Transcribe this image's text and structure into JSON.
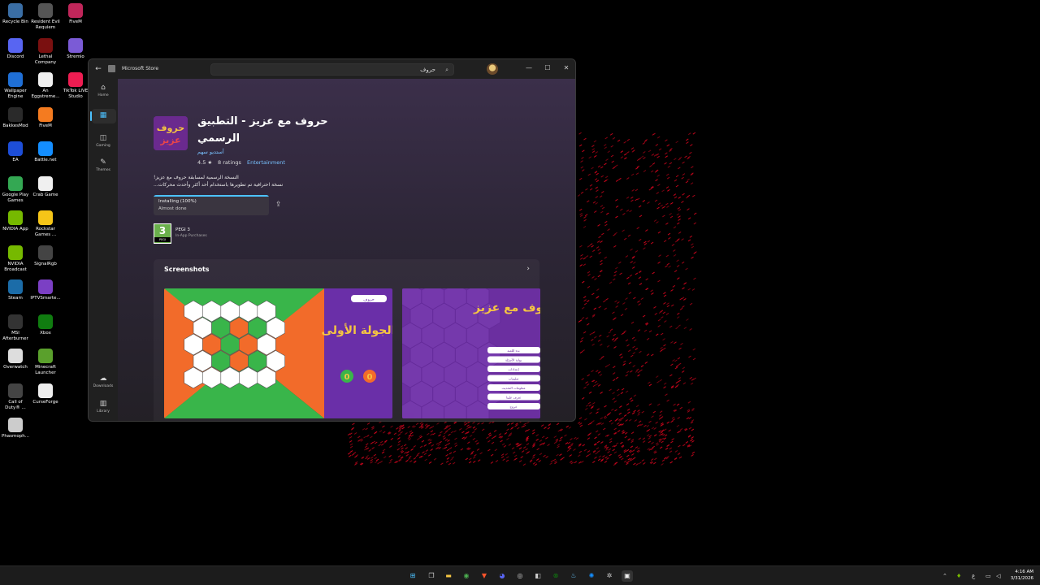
{
  "desktop": {
    "icons": [
      {
        "label": "Recycle Bin",
        "icon": "recycle-bin-icon",
        "color": "#3a6ea5"
      },
      {
        "label": "Resident Evil\nRequiem",
        "icon": "game-icon",
        "color": "#555555"
      },
      {
        "label": "FiveM",
        "icon": "fivem-icon",
        "color": "#c0265a"
      },
      {
        "label": "Discord",
        "icon": "discord-icon",
        "color": "#5865f2"
      },
      {
        "label": "Lethal\nCompany",
        "icon": "game-icon",
        "color": "#7a1010"
      },
      {
        "label": "Stremio",
        "icon": "stremio-icon",
        "color": "#7b5bd6"
      },
      {
        "label": "Wallpaper\nEngine",
        "icon": "wallpaper-engine-icon",
        "color": "#1f6fd6"
      },
      {
        "label": "An\nEggstreme...",
        "icon": "document-icon",
        "color": "#f0f0f0"
      },
      {
        "label": "TikTok LIVE\nStudio",
        "icon": "tiktok-icon",
        "color": "#ee1d52"
      },
      {
        "label": "BakkesMod",
        "icon": "bakkesmod-icon",
        "color": "#2a2a2a"
      },
      {
        "label": "FiveM",
        "icon": "fivem-icon",
        "color": "#f47b20"
      },
      {
        "label": "EA",
        "icon": "ea-icon",
        "color": "#1d4ed8"
      },
      {
        "label": "Battle.net",
        "icon": "battlenet-icon",
        "color": "#148eff"
      },
      {
        "label": "Google Play\nGames",
        "icon": "google-play-icon",
        "color": "#34a853"
      },
      {
        "label": "Crab Game",
        "icon": "document-icon",
        "color": "#f0f0f0"
      },
      {
        "label": "NVIDIA App",
        "icon": "nvidia-icon",
        "color": "#76b900"
      },
      {
        "label": "Rockstar\nGames ...",
        "icon": "rockstar-icon",
        "color": "#f5c518"
      },
      {
        "label": "NVIDIA\nBroadcast",
        "icon": "nvidia-icon",
        "color": "#76b900"
      },
      {
        "label": "SignalRgb",
        "icon": "signalrgb-icon",
        "color": "#444444"
      },
      {
        "label": "Steam",
        "icon": "steam-icon",
        "color": "#1b6ca8"
      },
      {
        "label": "IPTVSmarte...",
        "icon": "iptv-icon",
        "color": "#7b3fc4"
      },
      {
        "label": "MSI\nAfterburner",
        "icon": "msi-icon",
        "color": "#333333"
      },
      {
        "label": "Xbox",
        "icon": "xbox-icon",
        "color": "#107c10"
      },
      {
        "label": "Overwatch",
        "icon": "overwatch-icon",
        "color": "#dddddd"
      },
      {
        "label": "Minecraft\nLauncher",
        "icon": "minecraft-icon",
        "color": "#5aa02c"
      },
      {
        "label": "Call of\nDuty® ...",
        "icon": "game-icon",
        "color": "#444444"
      },
      {
        "label": "CurseForge",
        "icon": "curseforge-icon",
        "color": "#eeeeee"
      },
      {
        "label": "Phasmoph...",
        "icon": "phasmophobia-icon",
        "color": "#cccccc"
      }
    ]
  },
  "store": {
    "window_title": "Microsoft Store",
    "search_query": "حروف",
    "nav": [
      {
        "label": "Home",
        "icon": "home-icon"
      },
      {
        "label": "",
        "icon": "apps-icon"
      },
      {
        "label": "Gaming",
        "icon": "gamepad-icon"
      },
      {
        "label": "Themes",
        "icon": "brush-icon"
      },
      {
        "label": "Downloads",
        "icon": "cloud-download-icon"
      },
      {
        "label": "Library",
        "icon": "library-icon"
      }
    ],
    "app": {
      "name": "حروف مع عزيز - التطبيق الرسمي",
      "publisher": "أستديو سهم",
      "rating": "4.5 ★",
      "ratings_count": "8 ratings",
      "category": "Entertainment",
      "description_line1": "النسخة الرسمية لمسابقة حروف مع عزيز!",
      "description_line2": "نسخة احترافية تم تطويرها باستخدام أحد أكثر وأحدث محركات...",
      "install_status": "Installing (100%)",
      "install_substatus": "Almost done",
      "install_progress": 1.0,
      "pegi_number": "3",
      "pegi_badge_label": "PEGI",
      "pegi_title": "PEGI 3",
      "pegi_subtitle": "In-App Purchases"
    },
    "screenshots": {
      "title": "Screenshots",
      "shot1_round": "الجولة الأولى",
      "shot1_score_left": "0",
      "shot1_score_right": "0",
      "shot1_button": "حروف",
      "shot2_logo": "حروف مع عزيز",
      "shot2_menu": [
        "بدء اللعبة",
        "بوابة الأسئلة",
        "إعدادات",
        "تعليمات",
        "معلومات التحديث",
        "تعرف علينا",
        "خروج"
      ]
    }
  },
  "taskbar": {
    "time": "4:16 AM",
    "date": "3/31/2026",
    "lang": "ع"
  },
  "colors": {
    "accent": "#4cc2ff",
    "link": "#78c2ff",
    "pegi_green": "#6ab04c",
    "wallpaper_red": "#d1061e"
  }
}
